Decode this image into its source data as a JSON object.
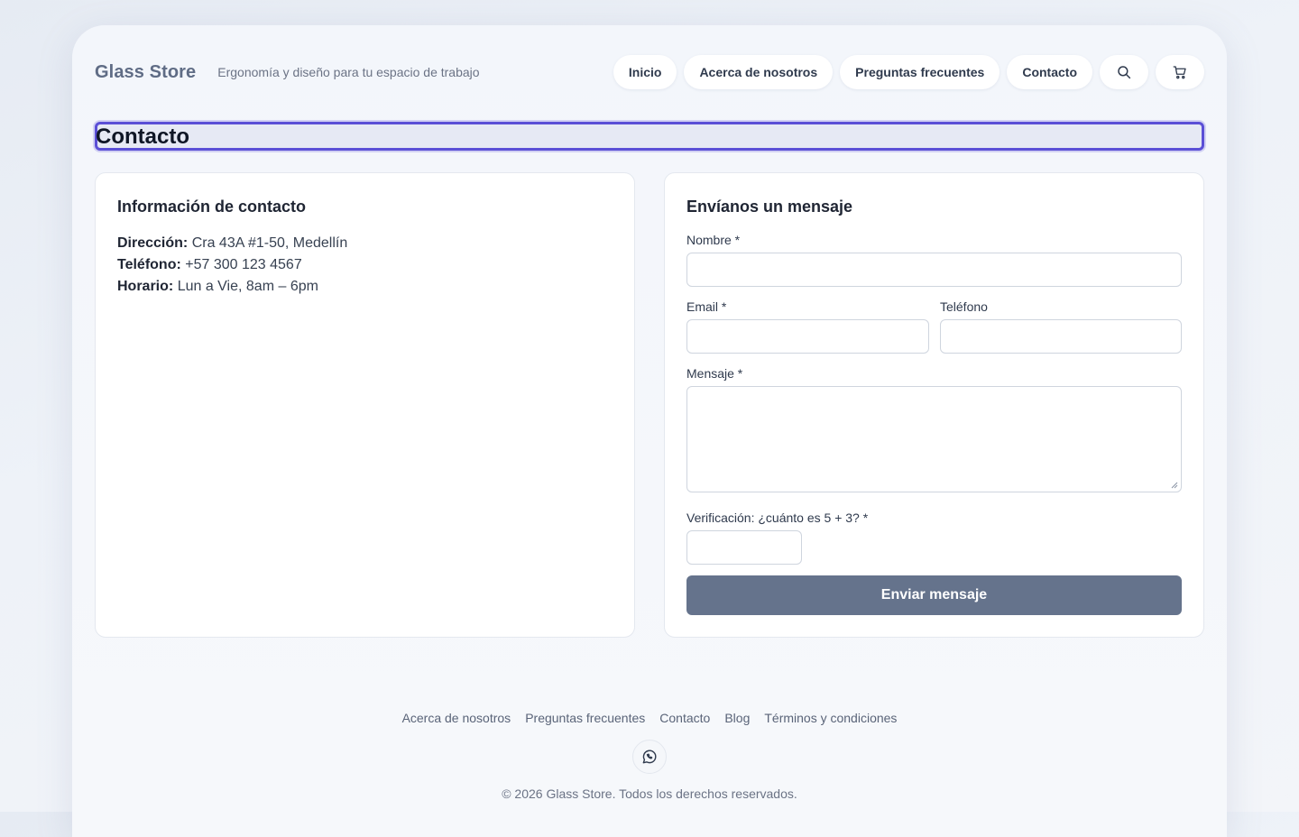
{
  "header": {
    "brand": "Glass Store",
    "tagline": "Ergonomía y diseño para tu espacio de trabajo",
    "nav": [
      "Inicio",
      "Acerca de nosotros",
      "Preguntas frecuentes",
      "Contacto"
    ],
    "icons": [
      "search-icon",
      "cart-icon"
    ]
  },
  "page": {
    "title": "Contacto"
  },
  "contact_info": {
    "heading": "Información de contacto",
    "address_label": "Dirección:",
    "address_value": "Cra 43A #1-50, Medellín",
    "phone_label": "Teléfono:",
    "phone_value": "+57 300 123 4567",
    "hours_label": "Horario:",
    "hours_value": "Lun a Vie, 8am – 6pm"
  },
  "form": {
    "heading": "Envíanos un mensaje",
    "name_label": "Nombre *",
    "email_label": "Email *",
    "phone_label": "Teléfono",
    "message_label": "Mensaje *",
    "verify_label": "Verificación: ¿cuánto es 5 + 3? *",
    "submit_label": "Enviar mensaje",
    "name_value": "",
    "email_value": "",
    "phone_value": "",
    "message_value": "",
    "verify_value": ""
  },
  "footer": {
    "links": [
      "Acerca de nosotros",
      "Preguntas frecuentes",
      "Contacto",
      "Blog",
      "Términos y condiciones"
    ],
    "social_icon": "whatsapp-icon",
    "copyright": "© 2026 Glass Store. Todos los derechos reservados."
  },
  "colors": {
    "accent_focus": "#5b4fd6",
    "button": "#65738c",
    "brand": "#5f6c85"
  }
}
